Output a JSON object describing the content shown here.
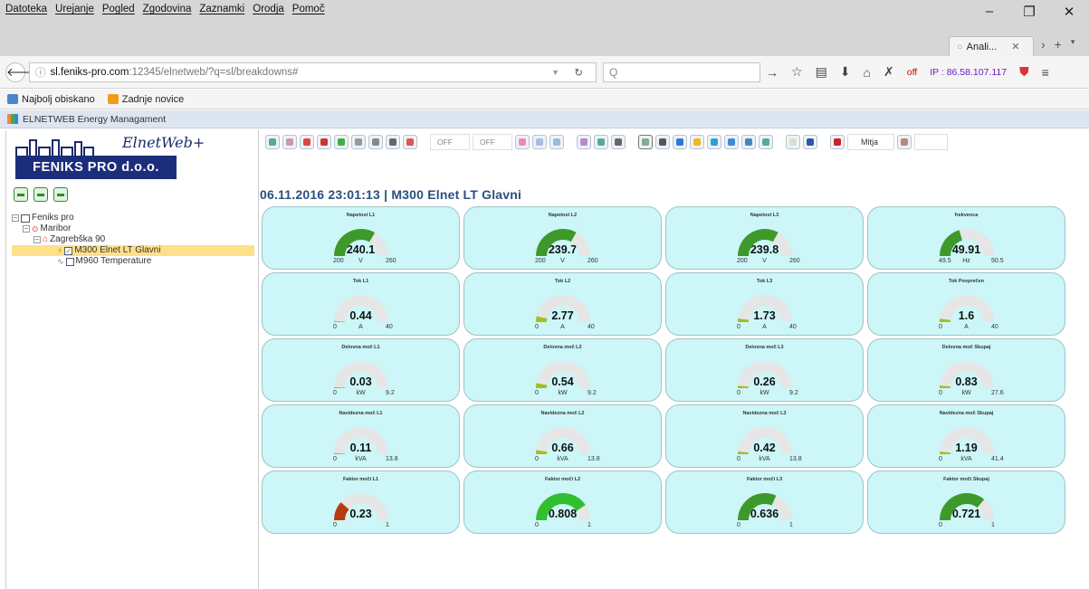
{
  "menu": [
    "Datoteka",
    "Urejanje",
    "Pogled",
    "Zgodovina",
    "Zaznamki",
    "Orodja",
    "Pomoč"
  ],
  "tab": {
    "label": "Anali...",
    "close": "✕"
  },
  "address": {
    "domain": "sl.feniks-pro.com",
    "rest": ":12345/elnetweb/?q=sl/breakdowns#"
  },
  "search": {
    "placeholder": "Q"
  },
  "toolbar_right": {
    "off_label": "off",
    "ip": "IP : 86.58.107.117"
  },
  "bookmarks": [
    "Najbolj obiskano",
    "Zadnje novice"
  ],
  "app_title": "ELNETWEB Energy Managament",
  "logo": {
    "script": "ElnetWeb+",
    "company": "FENIKS PRO d.o.o."
  },
  "tree": [
    {
      "label": "Feniks pro",
      "level": 0
    },
    {
      "label": "Maribor",
      "level": 1
    },
    {
      "label": "Zagrebška 90",
      "level": 2
    },
    {
      "label": "M300 Elnet LT Glavni",
      "level": 3,
      "selected": true
    },
    {
      "label": "M960 Temperature",
      "level": 3
    }
  ],
  "main_toolbar": {
    "off1": "OFF",
    "off2": "OFF",
    "user": "Mitja"
  },
  "heading": "06.11.2016  23:01:13   |   M300 Elnet LT Glavni",
  "gauges": [
    {
      "name": "Napetost L1",
      "value": "240.1",
      "unit": "V",
      "min": "200",
      "max": "260",
      "fraction": 0.668,
      "color": "#3d9a2a"
    },
    {
      "name": "Napetost L2",
      "value": "239.7",
      "unit": "V",
      "min": "200",
      "max": "260",
      "fraction": 0.662,
      "color": "#3d9a2a"
    },
    {
      "name": "Napetost L3",
      "value": "239.8",
      "unit": "V",
      "min": "200",
      "max": "260",
      "fraction": 0.663,
      "color": "#3d9a2a"
    },
    {
      "name": "frekvenca",
      "value": "49.91",
      "unit": "Hz",
      "min": "49.5",
      "max": "50.5",
      "fraction": 0.41,
      "color": "#3d9a2a"
    },
    {
      "name": "Tok L1",
      "value": "0.44",
      "unit": "A",
      "min": "0",
      "max": "40",
      "fraction": 0.011,
      "color": "#a0c020"
    },
    {
      "name": "Tok L2",
      "value": "2.77",
      "unit": "A",
      "min": "0",
      "max": "40",
      "fraction": 0.069,
      "color": "#a0c020"
    },
    {
      "name": "Tok L3",
      "value": "1.73",
      "unit": "A",
      "min": "0",
      "max": "40",
      "fraction": 0.043,
      "color": "#a0c020"
    },
    {
      "name": "Tok Povprečen",
      "value": "1.6",
      "unit": "A",
      "min": "0",
      "max": "40",
      "fraction": 0.04,
      "color": "#a0c020"
    },
    {
      "name": "Delovna moč L1",
      "value": "0.03",
      "unit": "kW",
      "min": "0",
      "max": "9.2",
      "fraction": 0.003,
      "color": "#a0c020"
    },
    {
      "name": "Delovna moč L2",
      "value": "0.54",
      "unit": "kW",
      "min": "0",
      "max": "9.2",
      "fraction": 0.059,
      "color": "#a0c020"
    },
    {
      "name": "Delovna moč L3",
      "value": "0.26",
      "unit": "kW",
      "min": "0",
      "max": "9.2",
      "fraction": 0.028,
      "color": "#a0c020"
    },
    {
      "name": "Delovna moč Skupaj",
      "value": "0.83",
      "unit": "kW",
      "min": "0",
      "max": "27.6",
      "fraction": 0.03,
      "color": "#a0c020"
    },
    {
      "name": "Navidezna moč L1",
      "value": "0.11",
      "unit": "kVA",
      "min": "0",
      "max": "13.8",
      "fraction": 0.008,
      "color": "#a0c020"
    },
    {
      "name": "Navidezna moč L2",
      "value": "0.66",
      "unit": "kVA",
      "min": "0",
      "max": "13.8",
      "fraction": 0.048,
      "color": "#a0c020"
    },
    {
      "name": "Navidezna moč L3",
      "value": "0.42",
      "unit": "kVA",
      "min": "0",
      "max": "13.8",
      "fraction": 0.03,
      "color": "#a0c020"
    },
    {
      "name": "Navidezna moč Skupaj",
      "value": "1.19",
      "unit": "kVA",
      "min": "0",
      "max": "41.4",
      "fraction": 0.029,
      "color": "#a0c020"
    },
    {
      "name": "Faktor moči L1",
      "value": "0.23",
      "unit": "",
      "min": "0",
      "max": "1",
      "fraction": 0.23,
      "color": "#b83a10"
    },
    {
      "name": "Faktor moči L2",
      "value": "0.808",
      "unit": "",
      "min": "0",
      "max": "1",
      "fraction": 0.808,
      "color": "#2fbf2f"
    },
    {
      "name": "Faktor moči L3",
      "value": "0.636",
      "unit": "",
      "min": "0",
      "max": "1",
      "fraction": 0.636,
      "color": "#3d9a2a"
    },
    {
      "name": "Faktor moči Skupaj",
      "value": "0.721",
      "unit": "",
      "min": "0",
      "max": "1",
      "fraction": 0.721,
      "color": "#3d9a2a"
    }
  ]
}
